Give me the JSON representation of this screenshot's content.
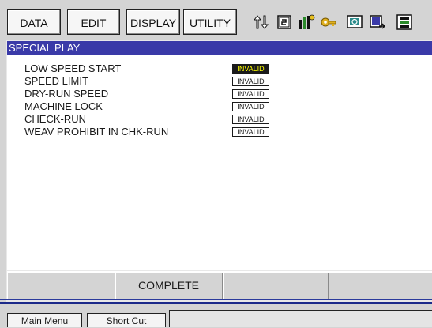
{
  "menu": {
    "data": "DATA",
    "edit": "EDIT",
    "display": "DISPLAY",
    "utility": "UTILITY"
  },
  "toolbar_icons": [
    "move-arrows-icon",
    "tool-select-icon",
    "robot-gauge-icon",
    "key-icon",
    "monitor-icon",
    "output-icon",
    "program-icon"
  ],
  "panel": {
    "title": "SPECIAL PLAY",
    "items": [
      {
        "label": "LOW SPEED START",
        "status": "INVALID",
        "selected": true
      },
      {
        "label": "SPEED LIMIT",
        "status": "INVALID",
        "selected": false
      },
      {
        "label": "DRY-RUN SPEED",
        "status": "INVALID",
        "selected": false
      },
      {
        "label": "MACHINE LOCK",
        "status": "INVALID",
        "selected": false
      },
      {
        "label": "CHECK-RUN",
        "status": "INVALID",
        "selected": false
      },
      {
        "label": "WEAV PROHIBIT IN CHK-RUN",
        "status": "INVALID",
        "selected": false
      }
    ]
  },
  "softkeys": [
    "",
    "COMPLETE",
    "",
    ""
  ],
  "bottom": {
    "main_menu": "Main Menu",
    "short_cut": "Short Cut"
  },
  "colors": {
    "title_bar": "#3a3aa8",
    "selected_bg": "#1a1a1a",
    "selected_text": "#ffff00"
  }
}
